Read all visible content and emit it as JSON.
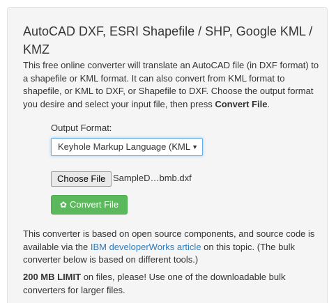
{
  "heading": "AutoCAD DXF, ESRI Shapefile / SHP, Google KML / KMZ",
  "intro": {
    "text": "This free online converter will translate an AutoCAD file (in DXF format) to a shapefile or KML format. It can also convert from KML format to shapefile, or KML to DXF, or Shapefile to DXF. Choose the output format you desire and select your input file, then press ",
    "bold": "Convert File",
    "end": "."
  },
  "form": {
    "output_label": "Output Format:",
    "output_selected": "Keyhole Markup Language (KML)",
    "choose_file_label": "Choose File",
    "file_name": "SampleD…bmb.dxf",
    "convert_label": "Convert File",
    "convert_icon": "gear-icon"
  },
  "description": {
    "before": "This converter is based on open source components, and source code is available via the ",
    "link": "IBM developerWorks article",
    "after": " on this topic. (The bulk converter below is based on different tools.)"
  },
  "limit": {
    "bold": "200 MB LIMIT",
    "text": " on files, please! Use one of the downloadable bulk converters for larger files."
  },
  "colors": {
    "panel_bg": "#f5f5f5",
    "button_green": "#5cb85c",
    "link_blue": "#337ab7",
    "focus_border": "#66afe9"
  }
}
